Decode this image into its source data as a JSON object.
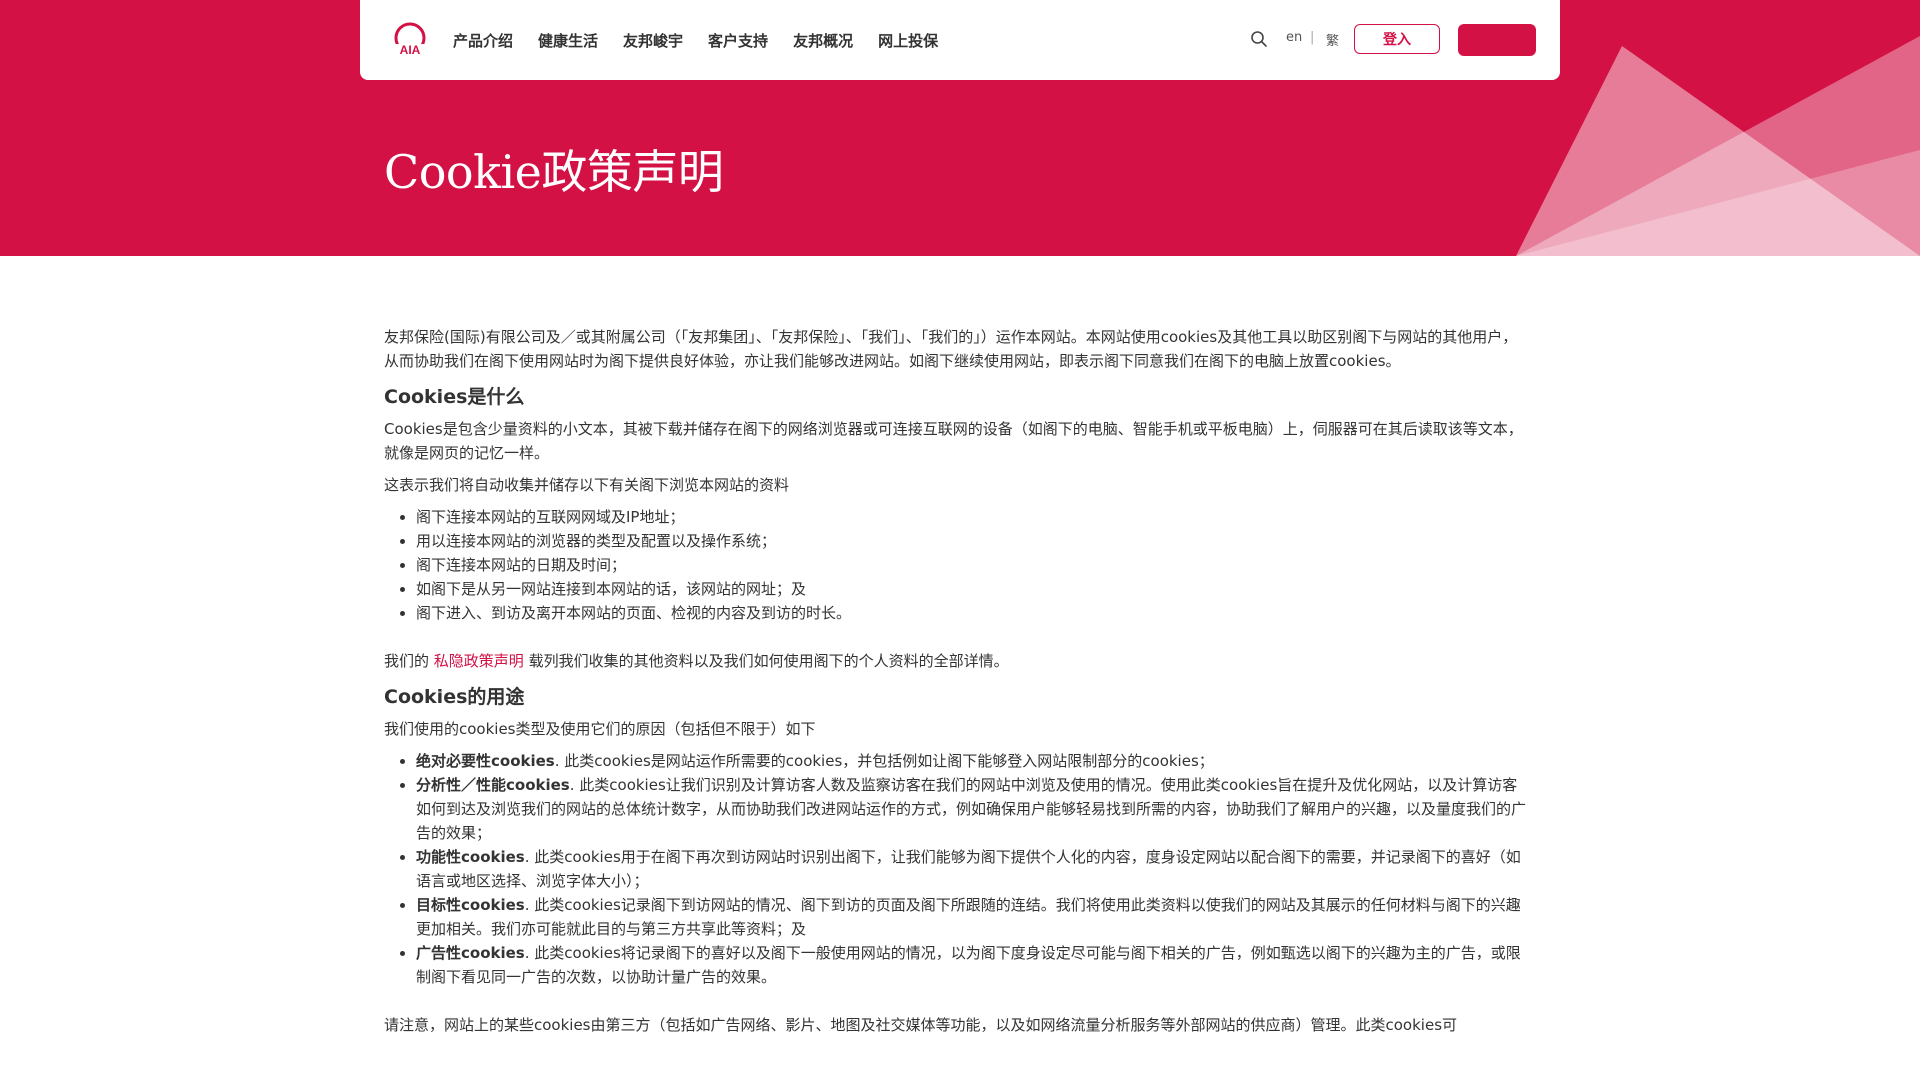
{
  "colors": {
    "brand": "#d31145",
    "text": "#333333",
    "background": "#ffffff"
  },
  "nav": {
    "logo": "aia-logo-icon",
    "items": [
      "产品介绍",
      "健康生活",
      "友邦峻宇",
      "客户支持",
      "友邦概况",
      "网上投保"
    ],
    "lang_en": "en",
    "lang_sep": "|",
    "lang_tc": "繁",
    "login_label": "登入"
  },
  "hero": {
    "title": "Cookie政策声明"
  },
  "content": {
    "intro": "友邦保险(国际)有限公司及／或其附属公司（「友邦集团」、「友邦保险」、「我们」、「我们的」）运作本网站。本网站使用cookies及其他工具以助区别阁下与网站的其他用户，从而协助我们在阁下使用网站时为阁下提供良好体验，亦让我们能够改进网站。如阁下继续使用网站，即表示阁下同意我们在阁下的电脑上放置cookies。",
    "h_what": "Cookies是什么",
    "what_text": "Cookies是包含少量资料的小文本，其被下载并储存在阁下的网络浏览器或可连接互联网的设备（如阁下的电脑、智能手机或平板电脑）上，伺服器可在其后读取该等文本，就像是网页的记忆一样。",
    "collect_intro": "这表示我们将自动收集并储存以下有关阁下浏览本网站的资料",
    "collect_items": [
      "阁下连接本网站的互联网网域及IP地址；",
      "用以连接本网站的浏览器的类型及配置以及操作系统；",
      "阁下连接本网站的日期及时间；",
      "如阁下是从另一网站连接到本网站的话，该网站的网址；及",
      "阁下进入、到访及离开本网站的页面、检视的内容及到访的时长。"
    ],
    "privacy_prefix": "我们的 ",
    "privacy_link": "私隐政策声明",
    "privacy_suffix": " 载列我们收集的其他资料以及我们如何使用阁下的个人资料的全部详情。",
    "h_use": "Cookies的用途",
    "use_intro": "我们使用的cookies类型及使用它们的原因（包括但不限于）如下",
    "use_items": [
      {
        "term": "绝对必要性cookies",
        "text": ". 此类cookies是网站运作所需要的cookies，并包括例如让阁下能够登入网站限制部分的cookies；"
      },
      {
        "term": "分析性／性能cookies",
        "text": ". 此类cookies让我们识别及计算访客人数及监察访客在我们的网站中浏览及使用的情况。使用此类cookies旨在提升及优化网站，以及计算访客如何到达及浏览我们的网站的总体统计数字，从而协助我们改进网站运作的方式，例如确保用户能够轻易找到所需的内容，协助我们了解用户的兴趣，以及量度我们的广告的效果；"
      },
      {
        "term": "功能性cookies",
        "text": ". 此类cookies用于在阁下再次到访网站时识别出阁下，让我们能够为阁下提供个人化的内容，度身设定网站以配合阁下的需要，并记录阁下的喜好（如语言或地区选择、浏览字体大小）；"
      },
      {
        "term": "目标性cookies",
        "text": ". 此类cookies记录阁下到访网站的情况、阁下到访的页面及阁下所跟随的连结。我们将使用此类资料以使我们的网站及其展示的任何材料与阁下的兴趣更加相关。我们亦可能就此目的与第三方共享此等资料；及"
      },
      {
        "term": "广告性cookies",
        "text": ". 此类cookies将记录阁下的喜好以及阁下一般使用网站的情况，以为阁下度身设定尽可能与阁下相关的广告，例如甄选以阁下的兴趣为主的广告，或限制阁下看见同一广告的次数，以协助计量广告的效果。"
      }
    ],
    "third_party": "请注意，网站上的某些cookies由第三方（包括如广告网络、影片、地图及社交媒体等功能，以及如网络流量分析服务等外部网站的供应商）管理。此类cookies可"
  }
}
